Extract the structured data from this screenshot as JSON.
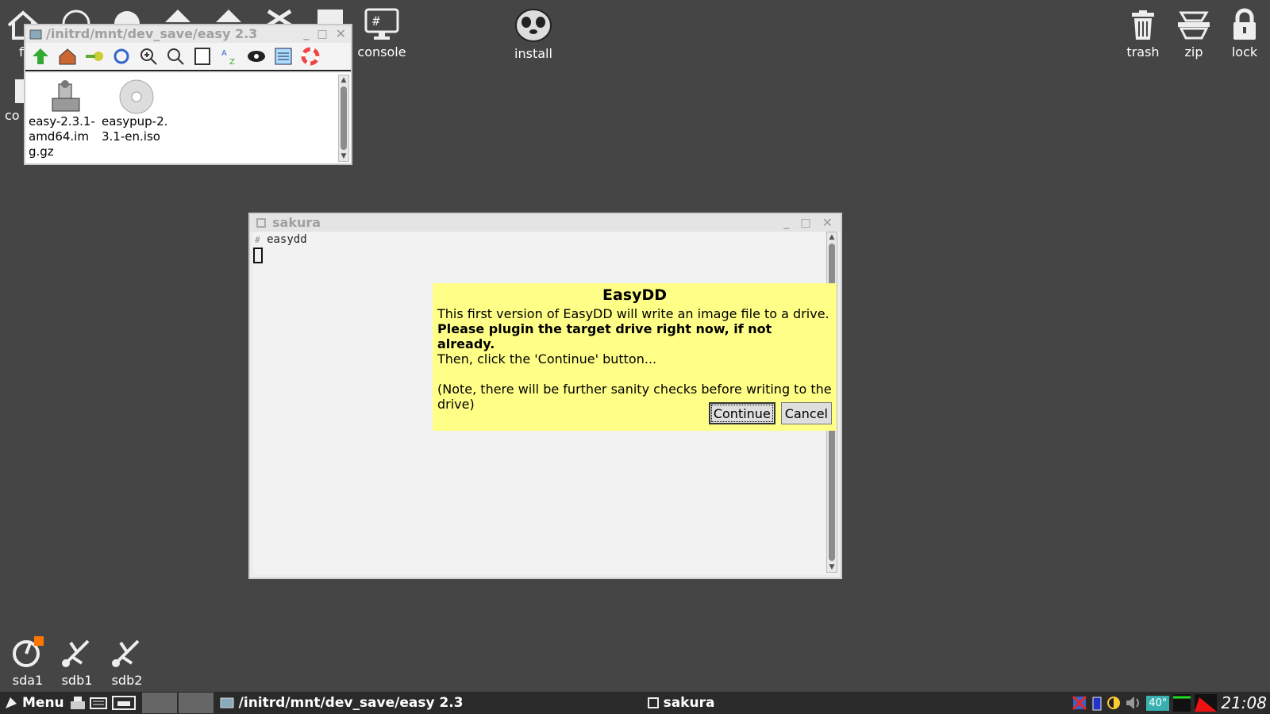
{
  "desktop": {
    "top_icons": [
      {
        "label": "console",
        "icon": "monitor-hash-icon"
      },
      {
        "label": "install",
        "icon": "puppy-icon"
      },
      {
        "label": "trash",
        "icon": "trash-icon"
      },
      {
        "label": "zip",
        "icon": "zip-icon"
      },
      {
        "label": "lock",
        "icon": "lock-icon"
      }
    ],
    "drive_icons": [
      {
        "label": "sda1",
        "icon": "drive-icon"
      },
      {
        "label": "sdb1",
        "icon": "usb-icon"
      },
      {
        "label": "sdb2",
        "icon": "usb-icon"
      }
    ],
    "partial_labels": [
      "fi",
      "co"
    ]
  },
  "file_manager": {
    "title": "/initrd/mnt/dev_save/easy 2.3",
    "files": [
      {
        "name": "easy-2.3.1-amd64.img.gz",
        "icon": "disk-image-icon"
      },
      {
        "name": "easypup-2.3.1-en.iso",
        "icon": "cd-icon"
      }
    ]
  },
  "terminal": {
    "title": "sakura",
    "prompt": "#",
    "command": "easydd"
  },
  "dialog": {
    "title": "EasyDD",
    "line1": "This first version of EasyDD will write an image file to a drive.",
    "line2": "Please plugin the target drive right now, if not already.",
    "line3": "Then, click the 'Continue' button...",
    "line4": "(Note, there will be further sanity checks before writing to the drive)",
    "continue_label": "Continue",
    "cancel_label": "Cancel"
  },
  "taskbar": {
    "menu_label": "Menu",
    "tasks": [
      {
        "label": "/initrd/mnt/dev_save/easy 2.3"
      },
      {
        "label": "sakura"
      }
    ],
    "temperature": "40°",
    "clock": "21:08"
  }
}
